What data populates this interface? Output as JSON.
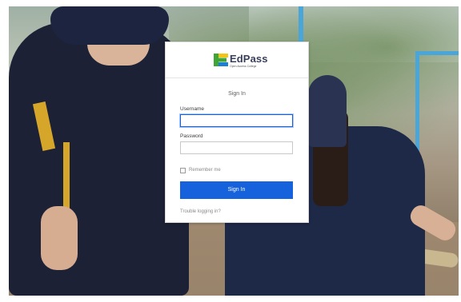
{
  "brand": {
    "name": "EdPass",
    "subtitle": "Open Access College"
  },
  "signin": {
    "heading": "Sign In",
    "username_label": "Username",
    "username_value": "",
    "password_label": "Password",
    "password_value": "",
    "remember_label": "Remember me",
    "remember_checked": false,
    "submit_label": "Sign In",
    "trouble_link": "Trouble logging in?"
  },
  "colors": {
    "primary": "#1662dd",
    "logo_green": "#3fa535",
    "logo_yellow": "#f2c319",
    "logo_blue": "#1c7fd1"
  },
  "icons": [
    "edpass-logo-icon"
  ]
}
